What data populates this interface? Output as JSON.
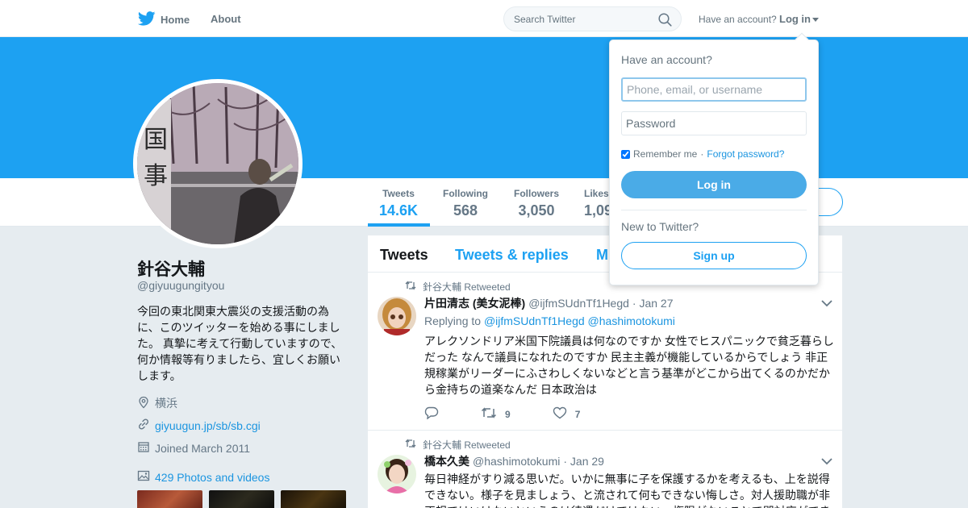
{
  "nav": {
    "home_label": "Home",
    "about_label": "About",
    "search_placeholder": "Search Twitter",
    "have_account": "Have an account?",
    "login_label": "Log in"
  },
  "profile": {
    "name": "針谷大輔",
    "handle": "@giyuugungityou",
    "bio": "今回の東北関東大震災の支援活動の為に、このツイッターを始める事にしました。 真摯に考えて行動していますので、何か情報等有りましたら、宜しくお願いします。",
    "location": "横浜",
    "website": "giyuugun.jp/sb/sb.cgi",
    "joined": "Joined March 2011",
    "photos_label": "429 Photos and videos"
  },
  "stats": [
    {
      "label": "Tweets",
      "value": "14.6K"
    },
    {
      "label": "Following",
      "value": "568"
    },
    {
      "label": "Followers",
      "value": "3,050"
    },
    {
      "label": "Likes",
      "value": "1,09"
    }
  ],
  "timeline": {
    "tabs": [
      "Tweets",
      "Tweets & replies",
      "M"
    ],
    "tweets": [
      {
        "retweeted_by": "針谷大輔 Retweeted",
        "name": "片田清志 (美女泥棒)",
        "screen_name": "@ijfmSUdnTf1Hegd",
        "date": "· Jan 27",
        "replying_prefix": "Replying to",
        "replying_to": "@ijfmSUdnTf1Hegd @hashimotokumi",
        "text": "アレクソンドリア米国下院議員は何なのですか 女性でヒスパニックで貧乏暮らしだった なんで議員になれたのですか 民主主義が機能しているからでしょう 非正規稼業がリーダーにふさわしくないなどと言う基準がどこから出てくるのかだから金持ちの道楽なんだ 日本政治は",
        "retweets": "9",
        "likes": "7"
      },
      {
        "retweeted_by": "針谷大輔 Retweeted",
        "name": "橋本久美",
        "screen_name": "@hashimotokumi",
        "date": "· Jan 29",
        "text": "毎日神経がすり減る思いだ。いかに無事に子を保護するかを考えるも、上を説得できない。様子を見ましょう、と流されて何もできない悔しさ。対人援助職が非正規ではいけないというのは待遇だけではない。権限がないことで即対応ができ"
      }
    ]
  },
  "login_dropdown": {
    "title": "Have an account?",
    "username_placeholder": "Phone, email, or username",
    "password_placeholder": "Password",
    "remember_label": "Remember me",
    "separator": "·",
    "forgot_label": "Forgot password?",
    "login_button": "Log in",
    "new_label": "New to Twitter?",
    "signup_button": "Sign up"
  },
  "colors": {
    "brand": "#1da1f2",
    "link": "#1b95e0",
    "background": "#e6ecf0"
  }
}
